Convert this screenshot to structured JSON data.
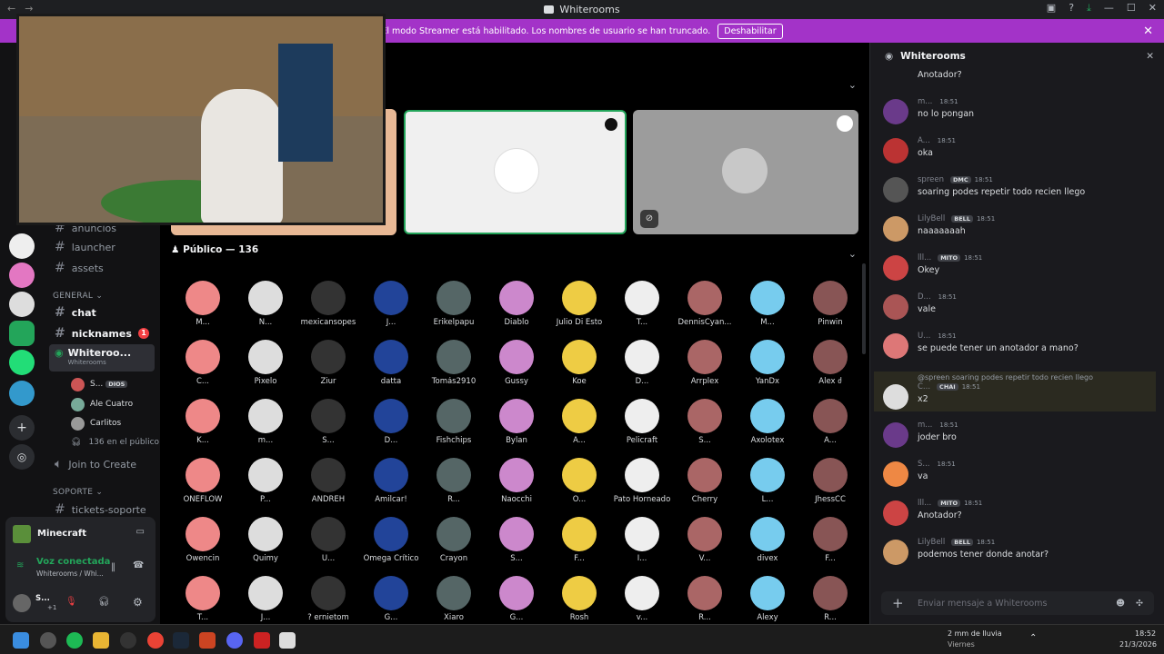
{
  "window": {
    "title": "Whiterooms"
  },
  "banner": {
    "text": "El modo Streamer está habilitado. Los nombres de usuario se han truncado.",
    "button": "Deshabilitar"
  },
  "channels": {
    "items_top": [
      {
        "name": "anuncios"
      },
      {
        "name": "launcher"
      },
      {
        "name": "assets"
      }
    ],
    "cat_general": "GENERAL",
    "chat": "chat",
    "nicknames": "nicknames",
    "nicknames_badge": "1",
    "voice_channel": "Whiteroo...",
    "voice_sub": "Whiterooms",
    "voice_users": [
      {
        "name": "S...",
        "tag": "DIOS"
      },
      {
        "name": "Ale Cuatro"
      },
      {
        "name": "Carlitos"
      }
    ],
    "public_count": "136 en el público",
    "join": "Join to Create",
    "cat_soporte": "SOPORTE",
    "tickets": "tickets-soporte"
  },
  "userpanel": {
    "activity": "Minecraft",
    "voice_status": "Voz conectada",
    "voice_location": "Whiterooms / Whi...",
    "user": "S...",
    "user_badge": "+1"
  },
  "main": {
    "public_header": "Público — 136",
    "people": [
      "M...",
      "N...",
      "mexicansopes",
      "J...",
      "Erikelpapu",
      "Diablo",
      "Julio Di Esto",
      "T...",
      "DennisCyan...",
      "M...",
      "Pinwin",
      "C...",
      "Pixelo",
      "Ziur",
      "datta",
      "Tomás2910",
      "Gussy",
      "Koe",
      "D...",
      "Arrplex",
      "YanDx",
      "Alex ძ",
      "K...",
      "m...",
      "S...",
      "D...",
      "Fishchips",
      "Bylan",
      "A...",
      "Pelicraft",
      "S...",
      "Axolotex",
      "A...",
      "ONEFLOW",
      "P...",
      "ANDREH",
      "Amilcar!",
      "R...",
      "Naocchi",
      "O...",
      "Pato Horneado",
      "Cherry",
      "L...",
      "JhessCC",
      "Owencin",
      "Quimy",
      "U...",
      "Omega Crítico",
      "Crayon",
      "S...",
      "F...",
      "I...",
      "V...",
      "divex",
      "F...",
      "T...",
      "J...",
      "? ernietom",
      "G...",
      "Xiaro",
      "G...",
      "Rosh",
      "v...",
      "R...",
      "Alexy",
      "R..."
    ]
  },
  "chat": {
    "header": "Whiterooms",
    "messages": [
      {
        "name": "",
        "time": "",
        "text": "Anotador?",
        "color": "#c44"
      },
      {
        "name": "m...",
        "time": "18:51",
        "text": "no lo pongan",
        "color": "#6a3a8a"
      },
      {
        "name": "A...",
        "time": "18:51",
        "text": "oka",
        "color": "#b33"
      },
      {
        "name": "spreen",
        "time": "18:51",
        "text": "soaring podes repetir todo recien llego",
        "tag": "DMC",
        "color": "#555"
      },
      {
        "name": "LilyBell",
        "time": "18:51",
        "text": "naaaaaaah",
        "tag": "BELL",
        "color": "#c96"
      },
      {
        "name": "lll...",
        "time": "18:51",
        "text": "Okey",
        "tag": "MITO",
        "color": "#c44"
      },
      {
        "name": "D...",
        "time": "18:51",
        "text": "vale",
        "color": "#a55"
      },
      {
        "name": "U...",
        "time": "18:51",
        "text": "se puede tener un anotador a mano?",
        "color": "#d77"
      },
      {
        "name": "C...",
        "time": "18:51",
        "text": "x2",
        "tag": "CHAI",
        "reply": "@spreen  soaring podes repetir todo recien llego",
        "color": "#ddd"
      },
      {
        "name": "m...",
        "time": "18:51",
        "text": "joder bro",
        "color": "#6a3a8a"
      },
      {
        "name": "S...",
        "time": "18:51",
        "text": "va",
        "color": "#e84"
      },
      {
        "name": "lll...",
        "time": "18:51",
        "text": "Anotador?",
        "tag": "MITO",
        "color": "#c44"
      },
      {
        "name": "LilyBell",
        "time": "18:51",
        "text": "podemos tener donde anotar?",
        "tag": "BELL",
        "color": "#c96"
      }
    ],
    "placeholder": "Enviar mensaje a Whiterooms"
  },
  "taskbar": {
    "weather": "2 mm de lluvia",
    "weather_day": "Viernes",
    "time": "18:52",
    "date": "21/3/2026"
  }
}
